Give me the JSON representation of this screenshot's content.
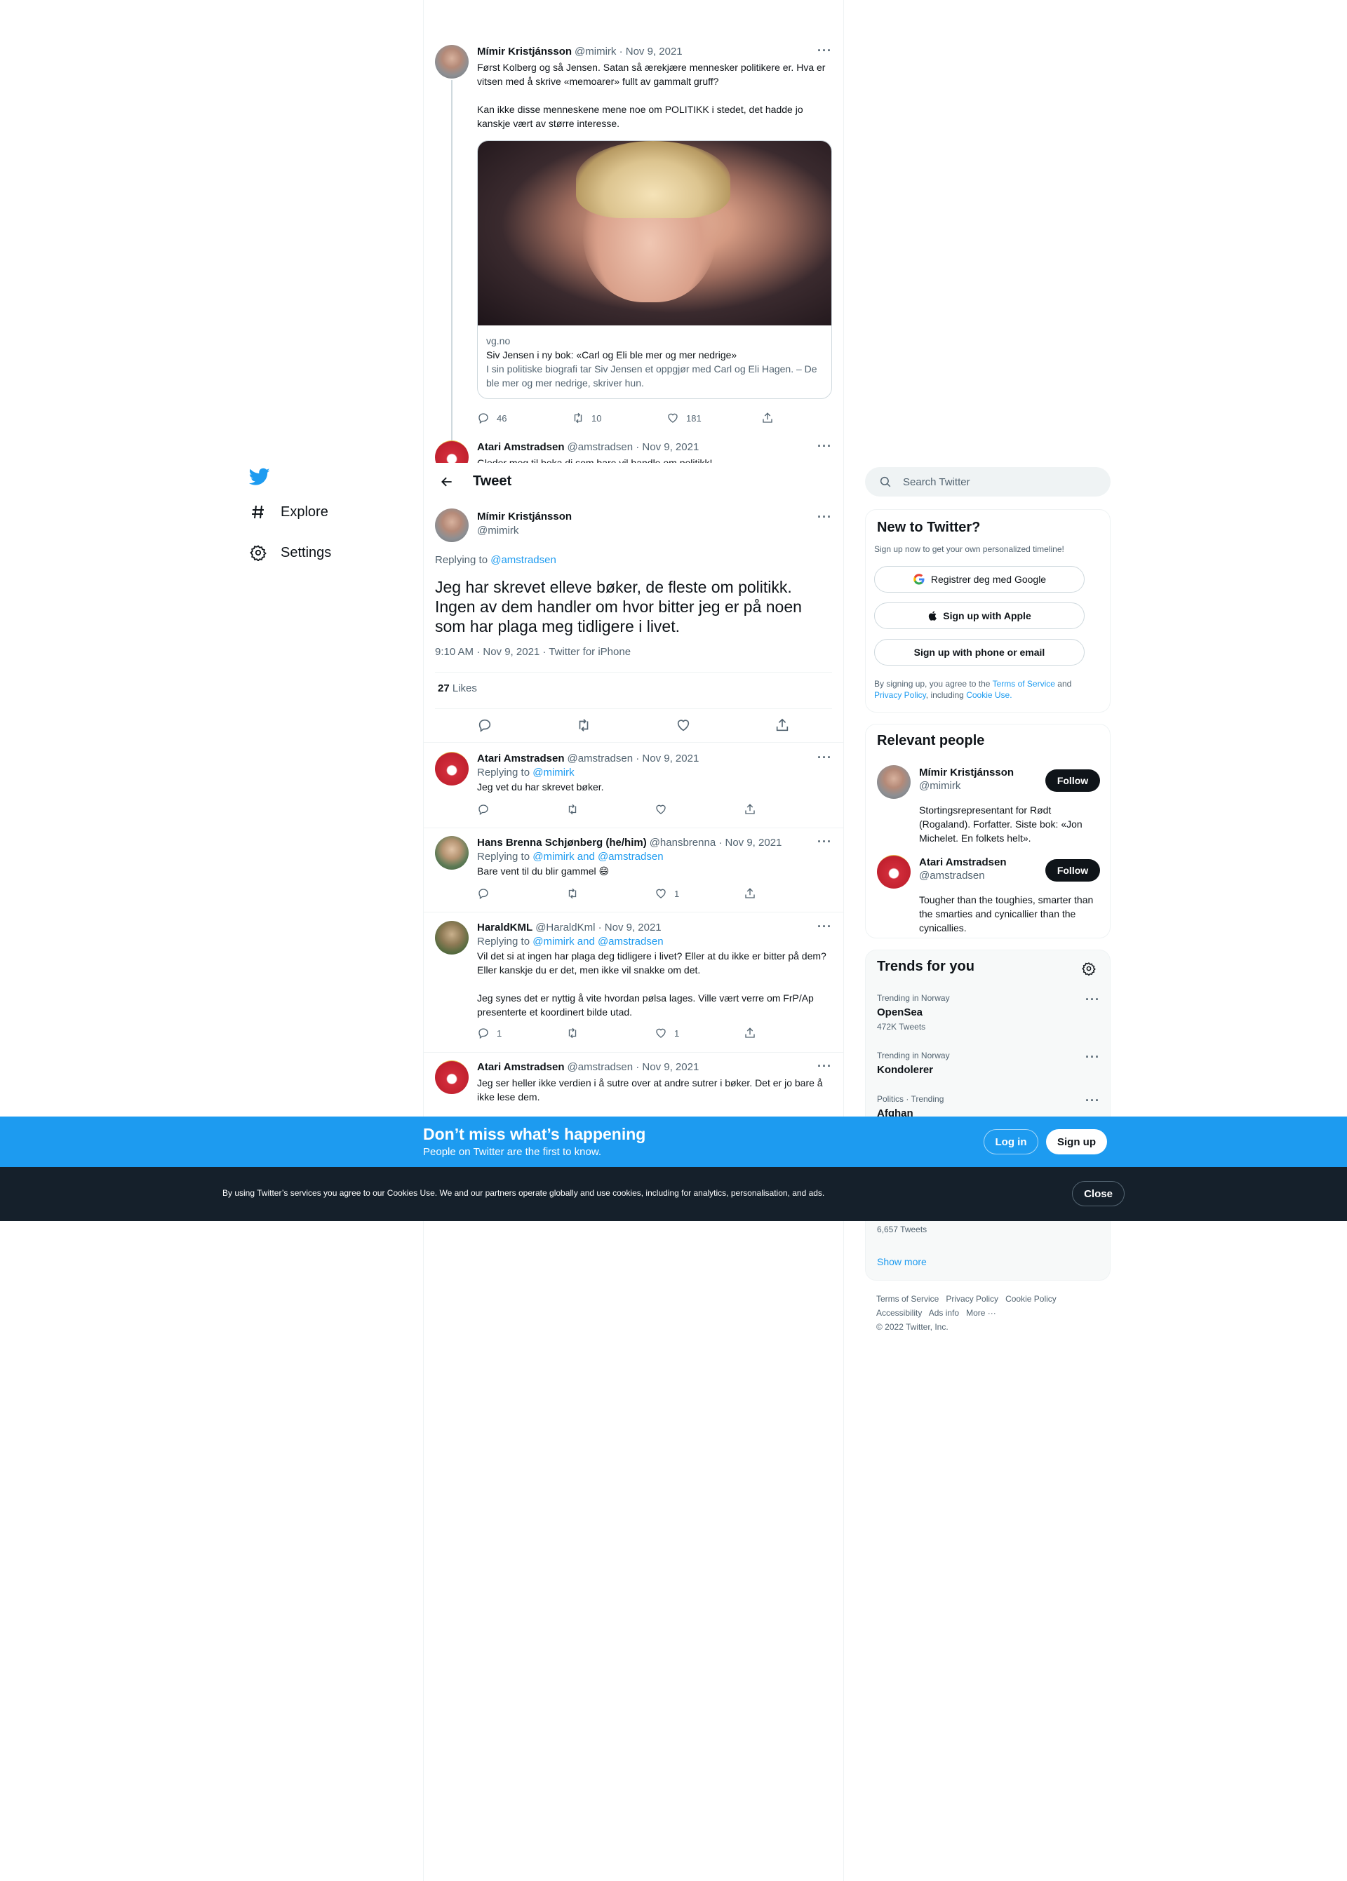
{
  "nav": {
    "items": [
      {
        "label": "Explore",
        "icon": "hashtag-icon"
      },
      {
        "label": "Settings",
        "icon": "gear-icon"
      }
    ]
  },
  "header": {
    "title": "Tweet"
  },
  "parent_tweet": {
    "name": "Mímir Kristjánsson",
    "meta": "@mimirk · Nov 9, 2021",
    "text": "Først Kolberg og så Jensen. Satan så ærekjære mennesker politikere er. Hva er vitsen med å skrive «memoarer» fullt av gammalt gruff?\n\nKan ikke disse menneskene mene noe om POLITIKK i stedet, det hadde jo kanskje vært av større interesse.",
    "card": {
      "domain": "vg.no",
      "title": "Siv Jensen i ny bok: «Carl og Eli ble mer og mer nedrige»",
      "description": "I sin politiske biografi tar Siv Jensen et oppgjør med Carl og Eli Hagen. – De ble mer og mer nedrige, skriver hun."
    },
    "replies": "46",
    "retweets": "10",
    "likes": "181"
  },
  "hidden_tweet": {
    "name": "Atari Amstradsen",
    "meta": "@amstradsen · Nov 9, 2021",
    "text": "Gleder meg til boka di som bare vil handle om politikk!"
  },
  "focal_tweet": {
    "name": "Mímir Kristjánsson",
    "handle": "@mimirk",
    "replying_label": "Replying to",
    "replying_to": "@amstradsen",
    "text": "Jeg har skrevet elleve bøker, de fleste om politikk. Ingen av dem handler om hvor bitter jeg er på noen som har plaga meg tidligere i livet.",
    "timestamp": "9:10 AM · Nov 9, 2021 · Twitter for iPhone",
    "likes_count": "27",
    "likes_label": "Likes"
  },
  "replies": [
    {
      "name": "Atari Amstradsen",
      "meta": "@amstradsen · Nov 9, 2021",
      "replying_label": "Replying to",
      "replying_to": "@mimirk",
      "text": "Jeg vet du har skrevet bøker.",
      "replies": "",
      "retweets": "",
      "likes": ""
    },
    {
      "name": "Hans Brenna Schjønberg (he/him)",
      "meta": "@hansbrenna · Nov 9, 2021",
      "replying_label": "Replying to",
      "replying_to": "@mimirk and @amstradsen",
      "text": "Bare vent til du blir gammel 😄",
      "replies": "",
      "retweets": "",
      "likes": "1"
    },
    {
      "name": "HaraldKML",
      "meta": "@HaraldKml · Nov 9, 2021",
      "replying_label": "Replying to",
      "replying_to": "@mimirk and @amstradsen",
      "text": "Vil det si at ingen har plaga deg tidligere i livet? Eller at du ikke er bitter på dem? Eller kanskje du er det, men ikke vil snakke om det.\n\nJeg synes det er nyttig å vite hvordan pølsa lages. Ville vært verre om FrP/Ap presenterte et koordinert bilde utad.",
      "replies": "1",
      "retweets": "",
      "likes": "1"
    },
    {
      "name": "Atari Amstradsen",
      "meta": "@amstradsen · Nov 9, 2021",
      "text": "Jeg ser heller ikke verdien i å sutre over at andre sutrer i bøker. Det er jo bare å ikke lese dem."
    }
  ],
  "search": {
    "placeholder": "Search Twitter"
  },
  "new_to_twitter": {
    "title": "New to Twitter?",
    "subtitle": "Sign up now to get your own personalized timeline!",
    "google": "Registrer deg med Google",
    "apple": "Sign up with Apple",
    "phone": "Sign up with phone or email",
    "terms_prefix": "By signing up, you agree to the",
    "terms": "Terms of Service",
    "and": "and",
    "privacy": "Privacy Policy",
    "including": ", including",
    "cookie": "Cookie Use."
  },
  "relevant_people": {
    "title": "Relevant people",
    "people": [
      {
        "name": "Mímir Kristjánsson",
        "handle": "@mimirk",
        "bio": "Stortingsrepresentant for Rødt (Rogaland). Forfatter. Siste bok: «Jon Michelet. En folkets helt».",
        "button": "Follow"
      },
      {
        "name": "Atari Amstradsen",
        "handle": "@amstradsen",
        "bio": "Tougher than the toughies, smarter than the smarties and cynicallier than the cynicallies.",
        "button": "Follow"
      }
    ]
  },
  "trends": {
    "title": "Trends for you",
    "items": [
      {
        "context": "Trending in Norway",
        "name": "OpenSea",
        "count": "472K Tweets"
      },
      {
        "context": "Trending in Norway",
        "name": "Kondolerer",
        "count": ""
      },
      {
        "context": "Politics · Trending",
        "name": "Afghan",
        "count": ""
      }
    ],
    "last_count": "6,657 Tweets",
    "show_more": "Show more"
  },
  "footer": {
    "links_row1": [
      "Terms of Service",
      "Privacy Policy",
      "Cookie Policy"
    ],
    "links_row2": [
      "Accessibility",
      "Ads info",
      "More ···"
    ],
    "copyright": "© 2022 Twitter, Inc."
  },
  "banner": {
    "title": "Don’t miss what’s happening",
    "subtitle": "People on Twitter are the first to know.",
    "login": "Log in",
    "signup": "Sign up"
  },
  "cookie_banner": {
    "text": "By using Twitter’s services you agree to our Cookies Use. We and our partners operate globally and use cookies, including for analytics, personalisation, and ads.",
    "close": "Close"
  },
  "colors": {
    "accent": "#1d9bf0",
    "text": "#0f1419",
    "secondary": "#536471",
    "dark": "#15202b"
  }
}
